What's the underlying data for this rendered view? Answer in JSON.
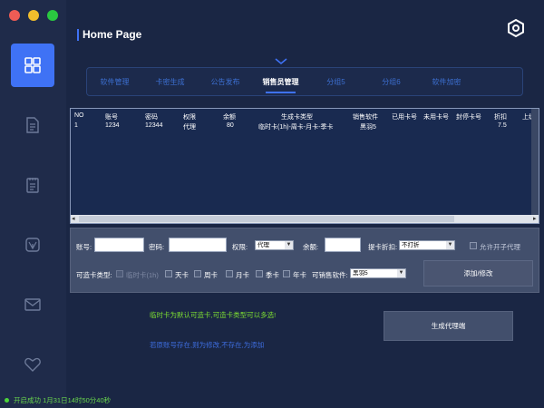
{
  "window": {
    "controls": [
      "close",
      "minimize",
      "maximize"
    ]
  },
  "sidebar": {
    "items": [
      {
        "icon": "grid-icon",
        "active": true
      },
      {
        "icon": "document-icon",
        "active": false
      },
      {
        "icon": "clipboard-icon",
        "active": false
      },
      {
        "icon": "leaf-icon",
        "active": false
      },
      {
        "icon": "mail-icon",
        "active": false
      },
      {
        "icon": "heart-icon",
        "active": false
      }
    ]
  },
  "header": {
    "title": "Home Page",
    "settings_icon": "hexagon-gear-icon"
  },
  "tabs": [
    {
      "label": "软件管理"
    },
    {
      "label": "卡密生成"
    },
    {
      "label": "公告发布"
    },
    {
      "label": "销售员管理",
      "active": true
    },
    {
      "label": "分组5"
    },
    {
      "label": "分组6"
    },
    {
      "label": "软件加密"
    }
  ],
  "table": {
    "columns": [
      "NO",
      "账号",
      "密码",
      "权限",
      "余额",
      "生成卡类型",
      "销售软件",
      "已用卡号",
      "未用卡号",
      "封停卡号",
      "折扣",
      "上级"
    ],
    "rows": [
      [
        "1",
        "1234",
        "12344",
        "代理",
        "80",
        "临时卡(1h)-周卡-月卡-季卡",
        "黑羽5",
        "",
        "",
        "",
        "7.5",
        ""
      ]
    ]
  },
  "form": {
    "account_label": "账号:",
    "account_value": "",
    "password_label": "密码:",
    "password_value": "",
    "permission_label": "权限:",
    "permission_value": "代理",
    "balance_label": "余额:",
    "balance_value": "",
    "discount_label": "提卡折扣:",
    "discount_value": "不打折",
    "allow_sub_label": "允许开子代理",
    "card_types_label": "可造卡类型:",
    "card_types": [
      "临时卡(1h)",
      "天卡",
      "周卡",
      "月卡",
      "季卡",
      "年卡"
    ],
    "sell_software_label": "可销售软件:",
    "sell_software_value": "黑羽5",
    "add_button": "添加/修改"
  },
  "notes": {
    "green": "临时卡为默认可造卡,可造卡类型可以多选!",
    "blue": "若原账号存在,则为修改,不存在,为添加"
  },
  "generate_button": "生成代理端",
  "status": {
    "text": "开启成功   1月31日14时50分40秒",
    "color": "#69d64d"
  },
  "colors": {
    "accent": "#3f72f5",
    "background": "#1a2644",
    "sidebar": "#1f2b4a"
  }
}
